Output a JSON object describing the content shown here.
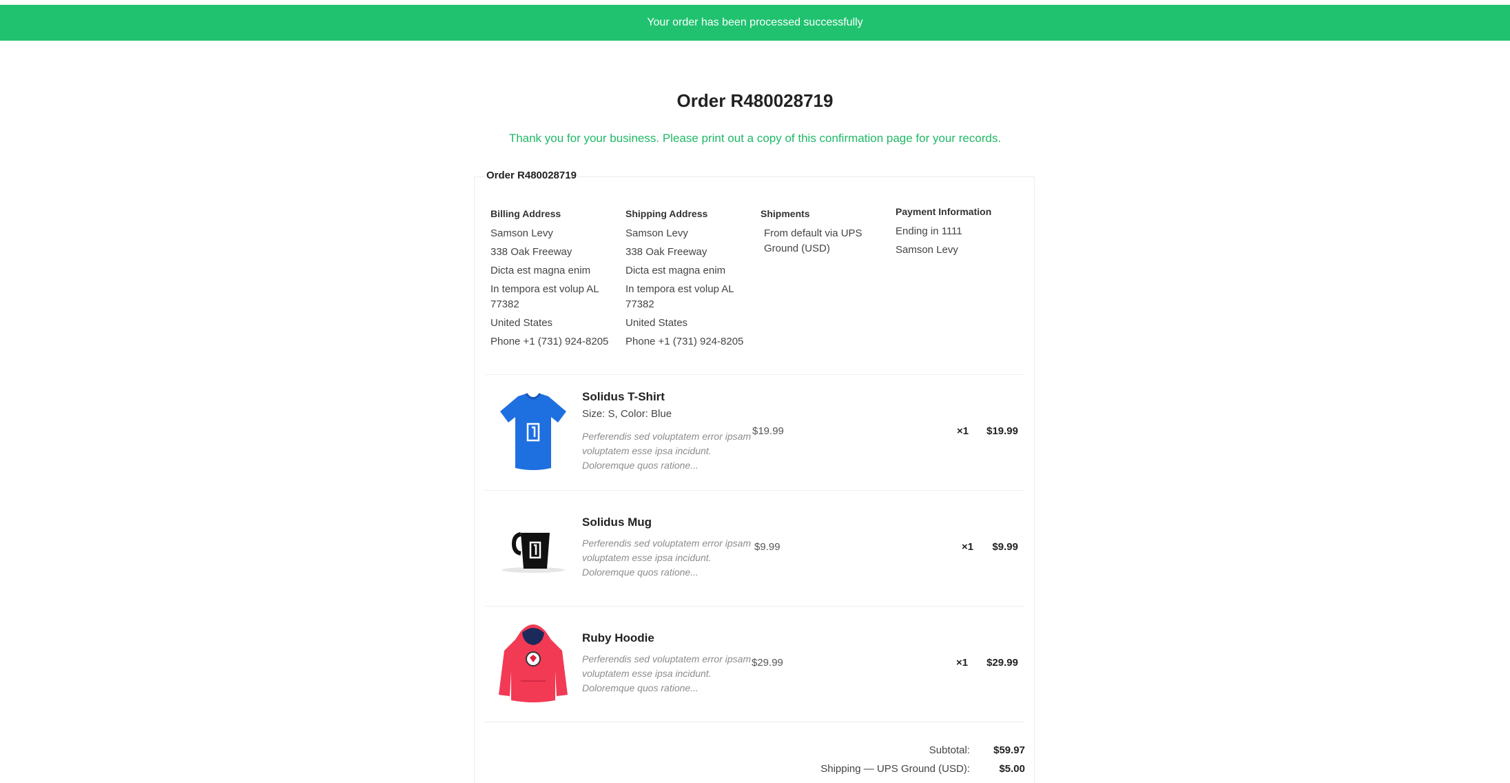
{
  "banner": {
    "message": "Your order has been processed successfully"
  },
  "page": {
    "title": "Order R480028719",
    "thanks": "Thank you for your business. Please print out a copy of this confirmation page for your records."
  },
  "order": {
    "legend": "Order R480028719",
    "billing": {
      "heading": "Billing Address",
      "name": "Samson Levy",
      "street": "338 Oak Freeway",
      "street2": "Dicta est magna enim",
      "city": "In tempora est volup AL 77382",
      "country": "United States",
      "phone": "Phone +1 (731) 924-8205"
    },
    "shipping": {
      "heading": "Shipping Address",
      "name": "Samson Levy",
      "street": "338 Oak Freeway",
      "street2": "Dicta est magna enim",
      "city": "In tempora est volup AL 77382",
      "country": "United States",
      "phone": "Phone +1 (731) 924-8205"
    },
    "shipments": {
      "heading": "Shipments",
      "text": "From default via UPS Ground (USD)"
    },
    "payment": {
      "heading": "Payment Information",
      "card": "Ending in 1111",
      "name": "Samson Levy"
    },
    "items": [
      {
        "name": "Solidus T-Shirt",
        "variant": "Size: S, Color: Blue",
        "description": "Perferendis sed voluptatem error ipsam voluptatem esse ipsa incidunt. Doloremque quos ratione...",
        "price": "$19.99",
        "qty": "×1",
        "total": "$19.99",
        "icon": "t-shirt-image",
        "color": "#1e6fe0"
      },
      {
        "name": "Solidus Mug",
        "variant": "",
        "description": "Perferendis sed voluptatem error ipsam voluptatem esse ipsa incidunt. Doloremque quos ratione...",
        "price": "$9.99",
        "qty": "×1",
        "total": "$9.99",
        "icon": "mug-image",
        "color": "#111111"
      },
      {
        "name": "Ruby Hoodie",
        "variant": "",
        "description": "Perferendis sed voluptatem error ipsam voluptatem esse ipsa incidunt. Doloremque quos ratione...",
        "price": "$29.99",
        "qty": "×1",
        "total": "$29.99",
        "icon": "hoodie-image",
        "color": "#f23a55"
      }
    ],
    "summary": {
      "subtotal_label": "Subtotal:",
      "subtotal_value": "$59.97",
      "shipping_label": "Shipping — UPS Ground (USD):",
      "shipping_value": "$5.00"
    }
  },
  "colors": {
    "success": "#20c26f",
    "success_text": "#1fb866"
  }
}
